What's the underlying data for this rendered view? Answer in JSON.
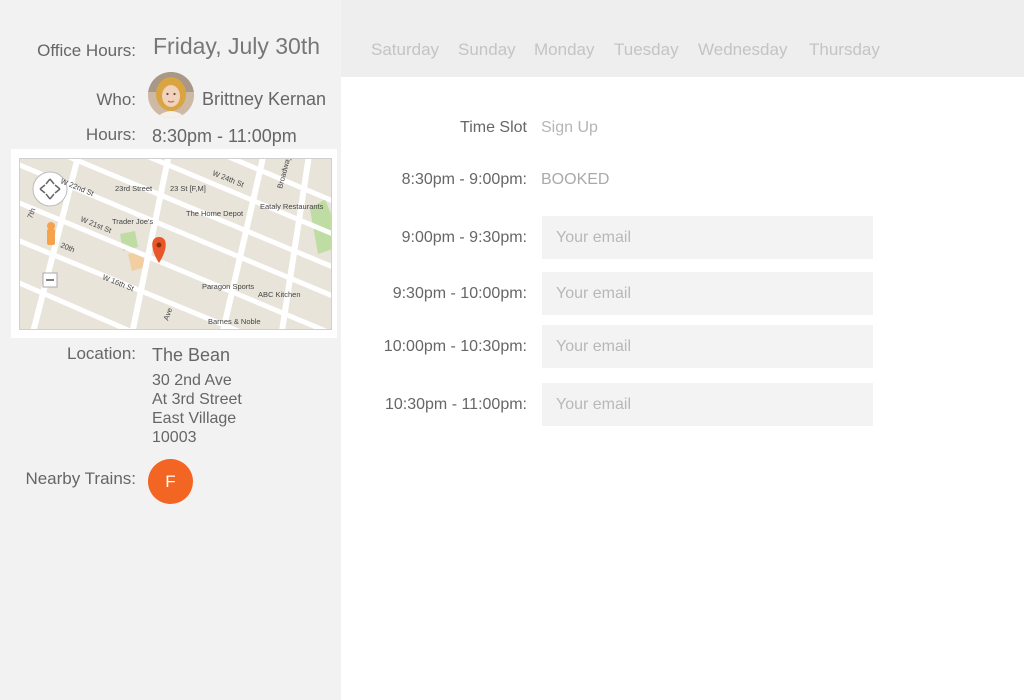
{
  "office": {
    "label": "Office Hours:",
    "date": "Friday, July 30th"
  },
  "who": {
    "label": "Who:",
    "name": "Brittney Kernan"
  },
  "hours": {
    "label": "Hours:",
    "value": "8:30pm - 11:00pm"
  },
  "map": {
    "streets": [
      "W 22nd St",
      "23rd Street",
      "23 St [F,M]",
      "W 24th St",
      "Broadway",
      "W 21st St",
      "Trader Joe's",
      "The Home Depot",
      "Eataly Restaurants",
      "20th",
      "W 16th St",
      "Paragon Sports",
      "ABC Kitchen",
      "Barnes & Noble",
      "Ave",
      "7th"
    ],
    "marker_color": "#e8562a"
  },
  "location": {
    "label": "Location:",
    "name": "The Bean",
    "address": [
      "30 2nd Ave",
      "At 3rd Street",
      "East Village",
      "10003"
    ]
  },
  "trains": {
    "label": "Nearby Trains:",
    "lines": [
      "F"
    ],
    "color": "#f26522"
  },
  "days": [
    "Saturday",
    "Sunday",
    "Monday",
    "Tuesday",
    "Wednesday",
    "Thursday"
  ],
  "schedule": {
    "col_time": "Time Slot",
    "col_signup": "Sign Up",
    "booked_text": "BOOKED",
    "email_placeholder": "Your email",
    "slots": [
      "8:30pm - 9:00pm:",
      "9:00pm - 9:30pm:",
      "9:30pm - 10:00pm:",
      "10:00pm - 10:30pm:",
      "10:30pm - 11:00pm:"
    ]
  }
}
